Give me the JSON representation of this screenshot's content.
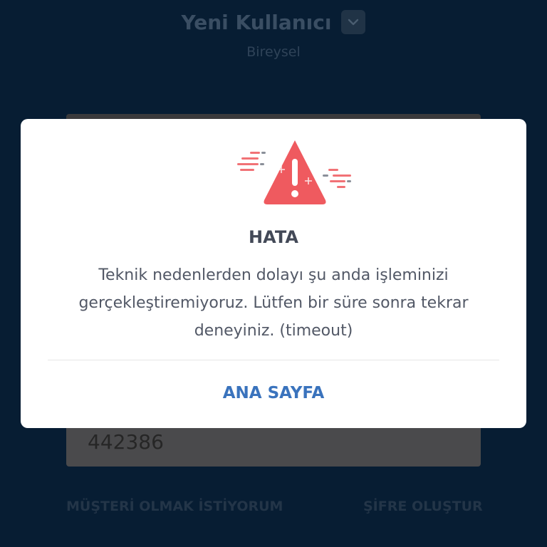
{
  "header": {
    "user_name": "Yeni Kullanıcı",
    "account_type": "Bireysel"
  },
  "form": {
    "code_value": "442386"
  },
  "footer": {
    "become_customer_label": "MÜŞTERİ OLMAK İSTİYORUM",
    "create_password_label": "ŞİFRE OLUŞTUR"
  },
  "modal": {
    "title": "HATA",
    "message": "Teknik nedenlerden dolayı şu anda işleminizi gerçekleştiremiyoruz. Lütfen bir süre sonra tekrar deneyiniz. (timeout)",
    "primary_button_label": "ANA SAYFA",
    "icon": "warning-triangle-icon"
  },
  "colors": {
    "background": "#071d33",
    "modal_background": "#ffffff",
    "warning_red": "#ef5a5f",
    "link_blue": "#3a73bd",
    "title_text": "#434957"
  }
}
